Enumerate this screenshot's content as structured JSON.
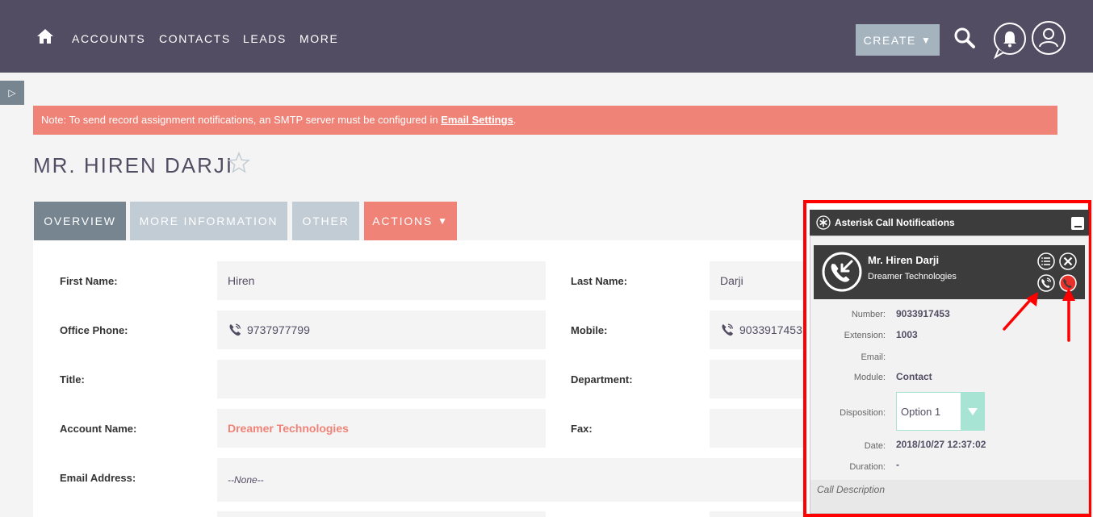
{
  "nav": {
    "items": [
      "ACCOUNTS",
      "CONTACTS",
      "LEADS",
      "MORE"
    ],
    "create_label": "CREATE"
  },
  "note": {
    "text": "Note: To send record assignment notifications, an SMTP server must be configured in ",
    "link": "Email Settings",
    "suffix": "."
  },
  "record": {
    "title": "MR. HIREN DARJI"
  },
  "tabs": {
    "overview": "OVERVIEW",
    "more_info": "MORE INFORMATION",
    "other": "OTHER",
    "actions": "ACTIONS"
  },
  "fields": {
    "first_name_label": "First Name:",
    "first_name": "Hiren",
    "last_name_label": "Last Name:",
    "last_name": "Darji",
    "office_phone_label": "Office Phone:",
    "office_phone": "9737977799",
    "mobile_label": "Mobile:",
    "mobile": "9033917453",
    "title_label": "Title:",
    "department_label": "Department:",
    "account_name_label": "Account Name:",
    "account_name": "Dreamer Technologies",
    "fax_label": "Fax:",
    "email_label": "Email Address:",
    "email": "--None--"
  },
  "notification": {
    "header": "Asterisk Call Notifications",
    "caller_name": "Mr. Hiren Darji",
    "caller_company": "Dreamer Technologies",
    "number_label": "Number:",
    "number": "9033917453",
    "extension_label": "Extension:",
    "extension": "1003",
    "email_label": "Email:",
    "module_label": "Module:",
    "module": "Contact",
    "disposition_label": "Disposition:",
    "disposition": "Option 1",
    "date_label": "Date:",
    "date": "2018/10/27 12:37:02",
    "duration_label": "Duration:",
    "duration": "-",
    "call_description_placeholder": "Call Description"
  },
  "colors": {
    "topbar": "#534d64",
    "accent": "#f08377",
    "tab_active": "#778591",
    "tab_inactive": "#c1ccd4",
    "highlight_border": "#ff0000",
    "disposition_accent": "#a8e4d4"
  }
}
